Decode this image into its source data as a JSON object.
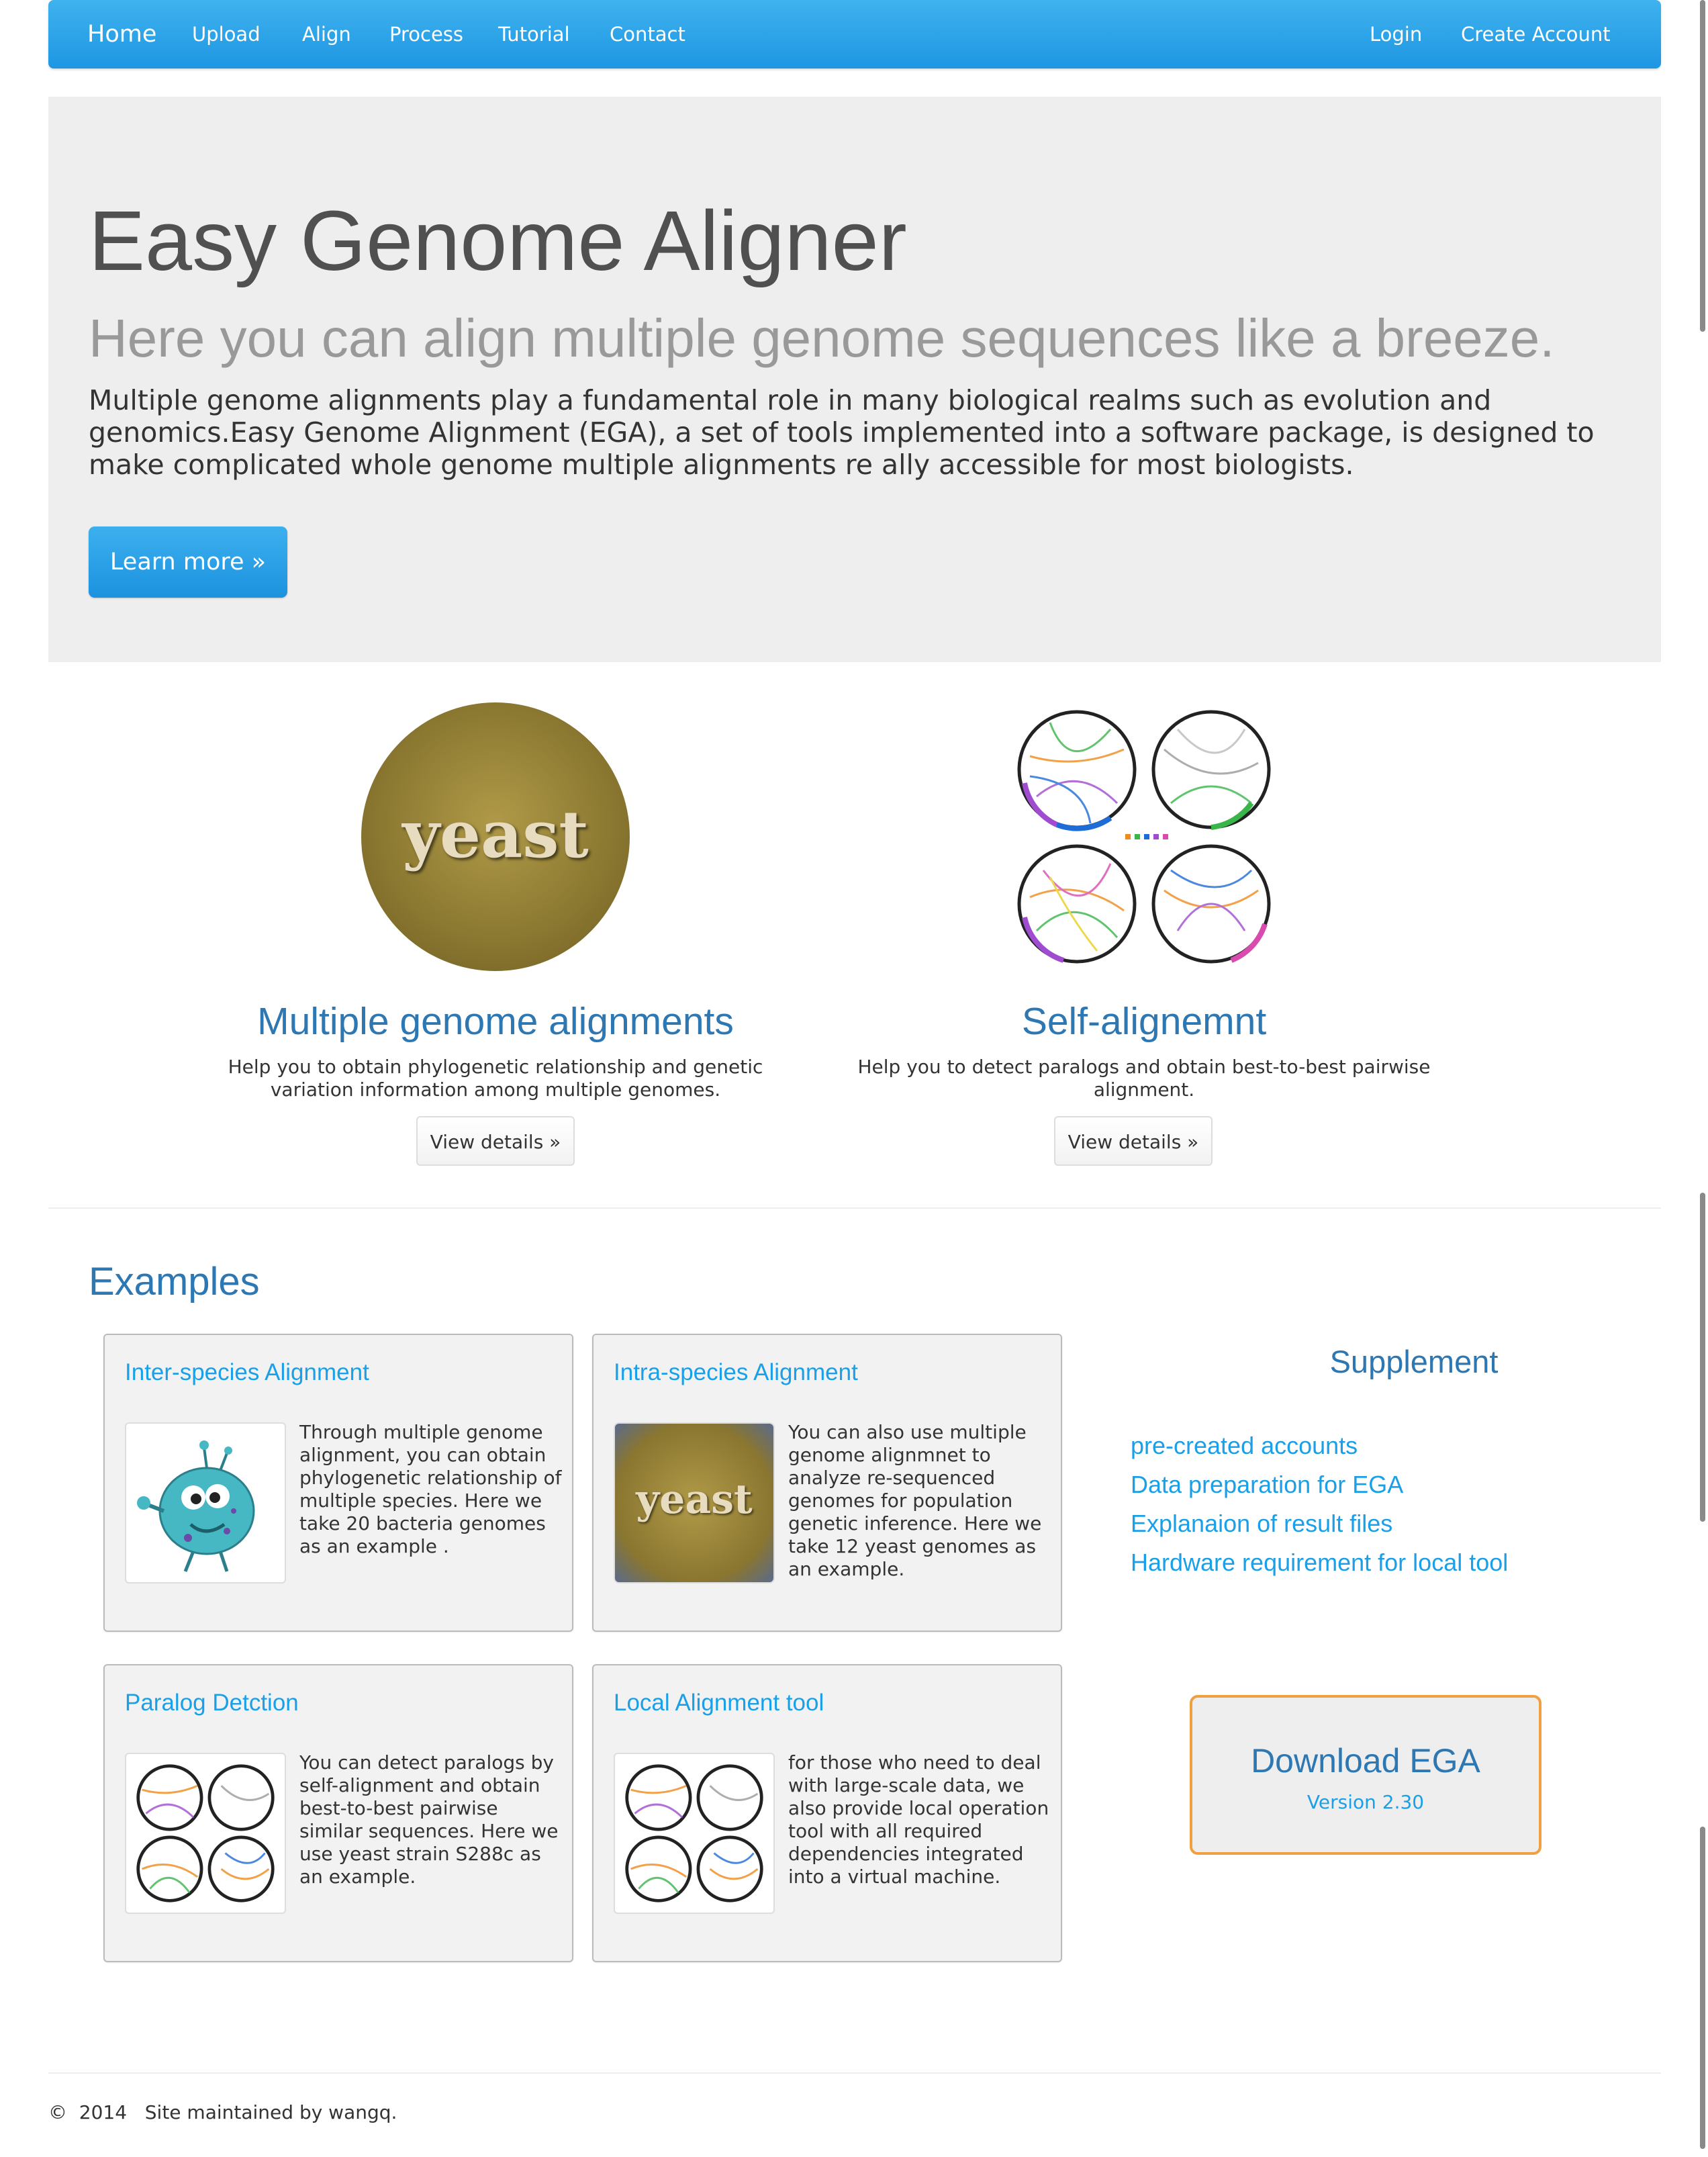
{
  "navbar": {
    "home": "Home",
    "items": [
      "Upload",
      "Align",
      "Process",
      "Tutorial",
      "Contact"
    ],
    "login": "Login",
    "create_account": "Create Account"
  },
  "jumbotron": {
    "title": "Easy Genome Aligner",
    "subtitle": "Here you can align multiple genome sequences like a breeze.",
    "description": "Multiple genome alignments play a fundamental role in many biological realms such as evolution and genomics.Easy Genome Alignment (EGA), a set of tools implemented into a software package, is designed to make complicated whole genome multiple alignments re ally accessible for most biologists.",
    "button": "Learn more »"
  },
  "features": [
    {
      "image_text": "yeast",
      "title": "Multiple genome alignments",
      "description": "Help you to obtain phylogenetic relationship and genetic variation information among multiple genomes.",
      "button": "View details »"
    },
    {
      "title": "Self-alignemnt",
      "description": "Help you to detect paralogs and obtain best-to-best pairwise alignment.",
      "button": "View details »"
    }
  ],
  "examples": {
    "title": "Examples",
    "cards": [
      {
        "title": "Inter-species Alignment",
        "thumb_icon": "bacteria-cartoon-icon",
        "text": "Through multiple genome alignment, you can obtain phylogenetic relationship of multiple species. Here we take 20 bacteria genomes as an example ."
      },
      {
        "title": "Intra-species Alignment",
        "thumb_text": "yeast",
        "text": "You can also use multiple genome alignmnet to analyze re-sequenced genomes for population genetic inference. Here we take 12 yeast genomes as an example."
      },
      {
        "title": "Paralog Detction",
        "thumb_icon": "circos-plot-icon",
        "text": "You can detect paralogs by self-alignment and obtain best-to-best pairwise similar sequences. Here we use yeast strain S288c as an example."
      },
      {
        "title": "Local Alignment tool",
        "thumb_icon": "circos-plot-icon",
        "text": "for those who need to deal with large-scale data, we also provide local operation tool with all required dependencies integrated into a virtual machine."
      }
    ]
  },
  "supplement": {
    "title": "Supplement",
    "links": [
      "pre-created accounts",
      "Data preparation for EGA",
      "Explanaion of result files",
      "Hardware requirement for local tool"
    ]
  },
  "download": {
    "title": "Download EGA",
    "version": "Version 2.30"
  },
  "footer": {
    "text": "©  2014   Site maintained by wangq."
  },
  "colors": {
    "navbar": "#2aa4ea",
    "heading_blue": "#2d77b2",
    "link_blue": "#19a0e8",
    "download_border": "#f0a040"
  }
}
